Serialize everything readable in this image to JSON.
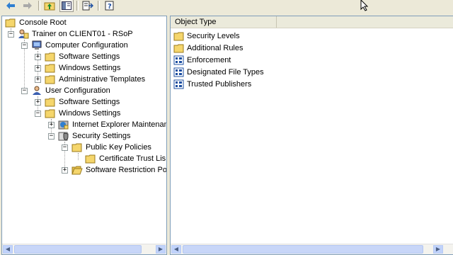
{
  "toolbar": {
    "buttons": [
      {
        "name": "back-button",
        "icon": "back-arrow-icon"
      },
      {
        "name": "forward-button",
        "icon": "forward-arrow-icon"
      },
      {
        "name": "up-one-level-button",
        "icon": "up-folder-icon"
      },
      {
        "name": "show-hide-tree-button",
        "icon": "console-tree-icon"
      },
      {
        "name": "export-list-button",
        "icon": "export-list-icon"
      },
      {
        "name": "help-button",
        "icon": "help-icon"
      }
    ]
  },
  "tree": {
    "console_root": "Console Root",
    "rsop": "Trainer on CLIENT01 - RSoP",
    "computer_config": "Computer Configuration",
    "cc_software": "Software Settings",
    "cc_windows": "Windows Settings",
    "cc_admin": "Administrative Templates",
    "user_config": "User Configuration",
    "uc_software": "Software Settings",
    "uc_windows": "Windows Settings",
    "ie_maint": "Internet Explorer Maintenan",
    "security": "Security Settings",
    "pki": "Public Key Policies",
    "cert_trust": "Certificate Trust Lis",
    "srp": "Software Restriction Po"
  },
  "list": {
    "column_header": "Object Type",
    "items": [
      {
        "label": "Security Levels",
        "icon": "folder-icon"
      },
      {
        "label": "Additional Rules",
        "icon": "folder-icon"
      },
      {
        "label": "Enforcement",
        "icon": "policy-icon"
      },
      {
        "label": "Designated File Types",
        "icon": "policy-icon"
      },
      {
        "label": "Trusted Publishers",
        "icon": "policy-icon"
      }
    ]
  },
  "colors": {
    "window_bg": "#ece9d8",
    "folder": "#f5d66c",
    "pane_border": "#7f9db9",
    "scroll": "#c1d3fb"
  }
}
